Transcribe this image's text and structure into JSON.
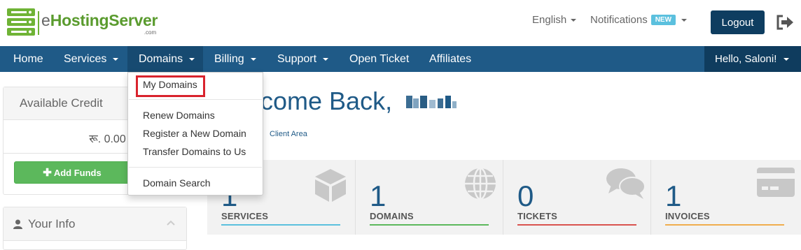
{
  "brand": {
    "prefix": "e",
    "name": "HostingServer",
    "suffix": ".com",
    "logo_color": "#6fb335"
  },
  "topbar": {
    "language": "English",
    "notifications": "Notifications",
    "new_badge": "NEW",
    "logout": "Logout",
    "signout_icon": "sign-out-icon"
  },
  "nav": {
    "items": [
      {
        "label": "Home"
      },
      {
        "label": "Services"
      },
      {
        "label": "Domains"
      },
      {
        "label": "Billing"
      },
      {
        "label": "Support"
      },
      {
        "label": "Open Ticket"
      },
      {
        "label": "Affiliates"
      }
    ],
    "user": "Hello, Saloni!",
    "bar_color": "#1f5a87"
  },
  "dropdown": {
    "items": [
      {
        "label": "My Domains"
      },
      {
        "label": "Renew Domains"
      },
      {
        "label": "Register a New Domain"
      },
      {
        "label": "Transfer Domains to Us"
      },
      {
        "label": "Domain Search"
      }
    ],
    "highlight_color": "#d9232d"
  },
  "sidebar": {
    "credit_title": "Available Credit",
    "credit_amount": "रू. 0.00",
    "add_funds": "Add Funds",
    "info_title": "Your Info"
  },
  "main": {
    "welcome": "Welcome Back,",
    "welcome_visible": "come Back,",
    "breadcrumb": "Client Area",
    "tiles": [
      {
        "value": "1",
        "label": "SERVICES",
        "icon": "cube-icon",
        "color": "#5bc0de"
      },
      {
        "value": "1",
        "label": "DOMAINS",
        "icon": "globe-icon",
        "color": "#5cb85c"
      },
      {
        "value": "0",
        "label": "TICKETS",
        "icon": "comments-icon",
        "color": "#d9534f"
      },
      {
        "value": "1",
        "label": "INVOICES",
        "icon": "credit-card-icon",
        "color": "#f0ad4e"
      }
    ]
  }
}
